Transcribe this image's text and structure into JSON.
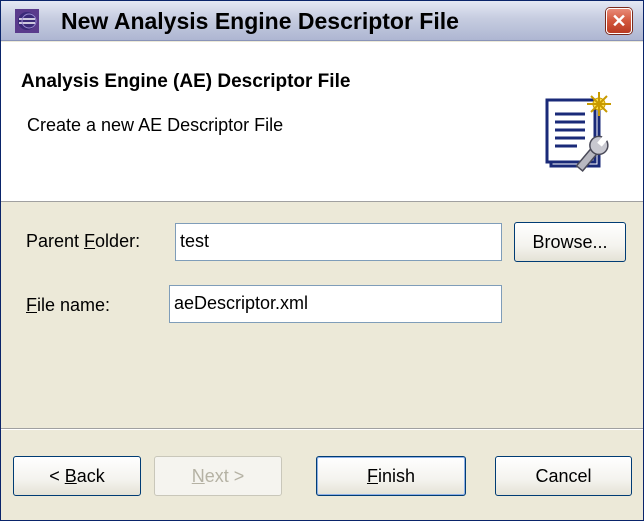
{
  "window": {
    "title": "New Analysis Engine Descriptor File",
    "close_glyph": "✕"
  },
  "banner": {
    "title": "Analysis Engine (AE) Descriptor File",
    "description": "Create a new AE Descriptor File",
    "icon": "descriptor-wizard-icon"
  },
  "form": {
    "parent_folder": {
      "label_prefix": "Parent ",
      "label_mnemonic": "F",
      "label_suffix": "older:",
      "value": "test"
    },
    "file_name": {
      "label_mnemonic": "F",
      "label_suffix": "ile name:",
      "value": "aeDescriptor.xml"
    },
    "browse_label": "Browse..."
  },
  "buttons": {
    "back_prefix": "< ",
    "back_mnemonic": "B",
    "back_suffix": "ack",
    "next_mnemonic": "N",
    "next_suffix": "ext >",
    "finish_mnemonic": "F",
    "finish_suffix": "inish",
    "cancel_label": "Cancel"
  },
  "colors": {
    "title_gradient_top": "#e4e8f4",
    "title_gradient_bottom": "#aeb6d2",
    "close_red": "#d2563c",
    "dialog_bg": "#ece9d8",
    "banner_bg": "#ffffff",
    "field_border": "#7f9db9"
  }
}
